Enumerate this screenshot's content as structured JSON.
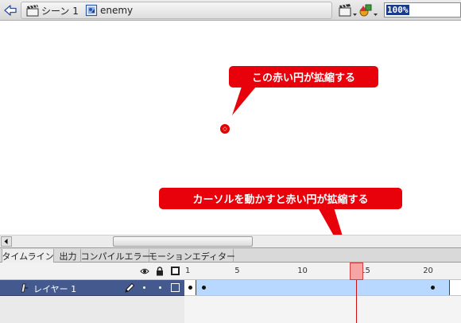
{
  "editbar": {
    "scene_label": "シーン 1",
    "symbol_label": "enemy",
    "zoom_value": "100%"
  },
  "stage": {
    "callout_top": "この赤い円が拡縮する",
    "callout_bottom": "カーソルを動かすと赤い円が拡縮する"
  },
  "panel_tabs": [
    "タイムライン",
    "出力",
    "コンパイルエラー",
    "モーションエディター"
  ],
  "timeline": {
    "ruler_labels": [
      "1",
      "5",
      "10",
      "15",
      "20"
    ],
    "current_frame": 15,
    "layer_name": "レイヤー 1",
    "total_frames": 20,
    "keyframes": [
      1,
      2,
      20
    ]
  },
  "colors": {
    "callout_red": "#e8000a",
    "layer_selected": "#445a8f",
    "tween_fill": "#b9d8ff",
    "playhead": "#cc1010"
  },
  "icons": {
    "back": "back-arrow-icon",
    "scene": "scene-clapper-icon",
    "symbol": "movieclip-symbol-icon",
    "edit_scene": "edit-scene-icon",
    "edit_symbol": "edit-symbol-icon",
    "eye": "eye-icon",
    "lock": "lock-icon",
    "outline": "outline-square-icon",
    "layer": "layer-icon",
    "pencil": "pencil-icon"
  }
}
